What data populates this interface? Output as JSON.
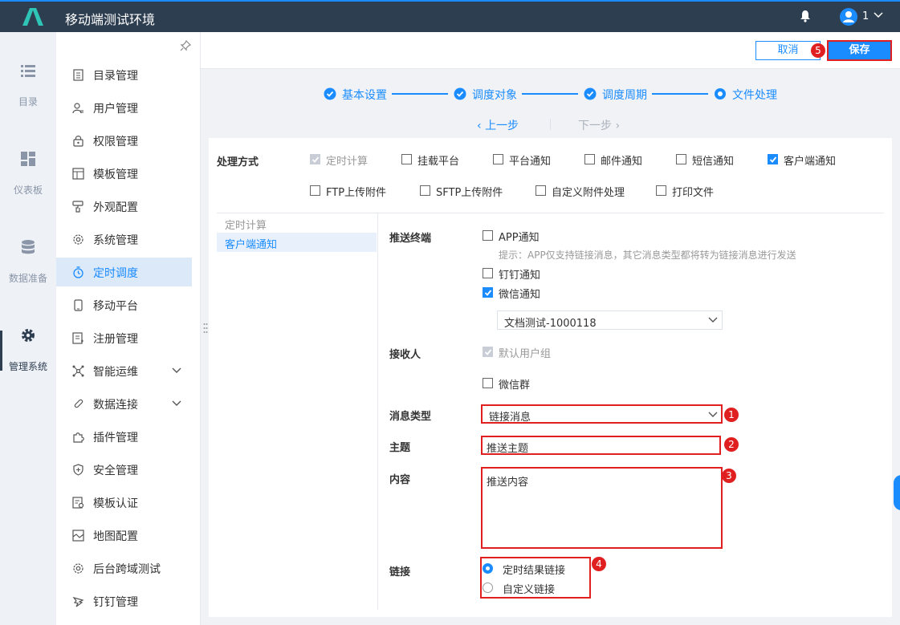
{
  "header": {
    "app_title": "移动端测试环境",
    "user_name": "1"
  },
  "rail": {
    "items": [
      {
        "label": "目录",
        "icon": "list-icon"
      },
      {
        "label": "仪表板",
        "icon": "dashboard-icon"
      },
      {
        "label": "数据准备",
        "icon": "database-icon"
      },
      {
        "label": "管理系统",
        "icon": "gear-icon"
      }
    ]
  },
  "menu": {
    "items": [
      {
        "label": "目录管理",
        "icon": "catalog-icon"
      },
      {
        "label": "用户管理",
        "icon": "user-icon"
      },
      {
        "label": "权限管理",
        "icon": "lock-icon"
      },
      {
        "label": "模板管理",
        "icon": "template-icon"
      },
      {
        "label": "外观配置",
        "icon": "brush-icon"
      },
      {
        "label": "系统管理",
        "icon": "settings-icon"
      },
      {
        "label": "定时调度",
        "icon": "timer-icon"
      },
      {
        "label": "移动平台",
        "icon": "mobile-icon"
      },
      {
        "label": "注册管理",
        "icon": "register-icon"
      },
      {
        "label": "智能运维",
        "icon": "network-icon"
      },
      {
        "label": "数据连接",
        "icon": "link-icon"
      },
      {
        "label": "插件管理",
        "icon": "puzzle-icon"
      },
      {
        "label": "安全管理",
        "icon": "shield-icon"
      },
      {
        "label": "模板认证",
        "icon": "certificate-icon"
      },
      {
        "label": "地图配置",
        "icon": "map-icon"
      },
      {
        "label": "后台跨域测试",
        "icon": "settings-icon"
      },
      {
        "label": "钉钉管理",
        "icon": "dingtalk-icon"
      }
    ],
    "active_index": 6
  },
  "toolbar": {
    "cancel_label": "取消",
    "save_label": "保存"
  },
  "badges": [
    "1",
    "2",
    "3",
    "4",
    "5"
  ],
  "steps": [
    "基本设置",
    "调度对象",
    "调度周期",
    "文件处理"
  ],
  "nav": {
    "prev": "上一步",
    "next": "下一步"
  },
  "processing": {
    "label": "处理方式",
    "options_row1": [
      {
        "label": "定时计算",
        "state": "disabled-checked"
      },
      {
        "label": "挂载平台",
        "state": "unchecked"
      },
      {
        "label": "平台通知",
        "state": "unchecked"
      },
      {
        "label": "邮件通知",
        "state": "unchecked"
      },
      {
        "label": "短信通知",
        "state": "unchecked"
      },
      {
        "label": "客户端通知",
        "state": "checked"
      }
    ],
    "options_row2": [
      {
        "label": "FTP上传附件",
        "state": "unchecked"
      },
      {
        "label": "SFTP上传附件",
        "state": "unchecked"
      },
      {
        "label": "自定义附件处理",
        "state": "unchecked"
      },
      {
        "label": "打印文件",
        "state": "unchecked"
      }
    ]
  },
  "left_list": {
    "header": "定时计算",
    "selected": "客户端通知"
  },
  "form": {
    "terminal_label": "推送终端",
    "app_notice": "APP通知",
    "hint": "提示：APP仅支持链接消息，其它消息类型都将转为链接消息进行发送",
    "dingtalk_notice": "钉钉通知",
    "wechat_notice": "微信通知",
    "wechat_select": "文档测试-1000118",
    "receiver_label": "接收人",
    "default_group": "默认用户组",
    "wechat_group": "微信群",
    "msg_type_label": "消息类型",
    "msg_type_value": "链接消息",
    "subject_label": "主题",
    "subject_value": "推送主题",
    "content_label": "内容",
    "content_value": "推送内容",
    "link_label": "链接",
    "link_options": [
      "定时结果链接",
      "自定义链接"
    ],
    "link_selected": 0
  },
  "colors": {
    "accent": "#1a8cff",
    "topbar": "#2e3e51",
    "highlight": "#e02020"
  }
}
